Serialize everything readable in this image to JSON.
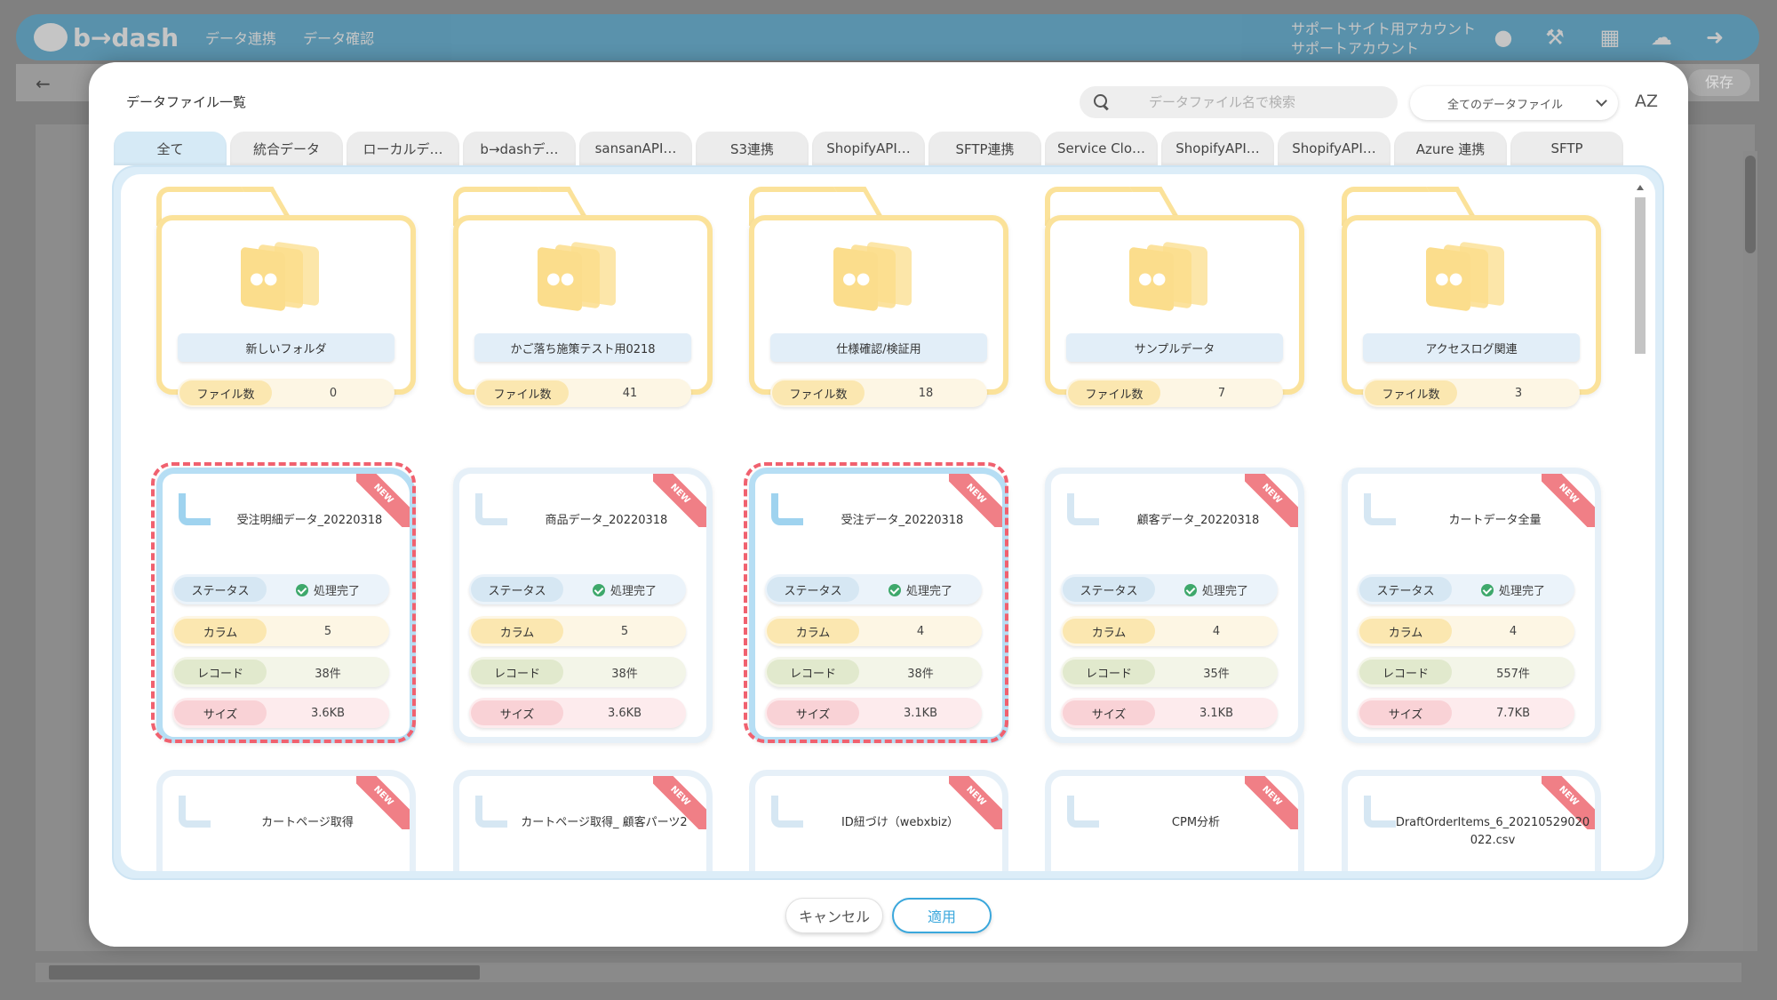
{
  "app": {
    "logo": "b→dash",
    "nav": [
      "データ連携",
      "データ確認"
    ],
    "account_line1": "サポートサイト用アカウント",
    "account_line2": "サポートアカウント",
    "save_label": "保存"
  },
  "modal": {
    "title": "データファイル一覧",
    "search_placeholder": "データファイル名で検索",
    "filter_selected": "全てのデータファイル",
    "sort_label": "AZ",
    "tabs": [
      "全て",
      "統合データ",
      "ローカルデ…",
      "b→dashデ…",
      "sansanAPI…",
      "S3連携",
      "ShopifyAPI…",
      "SFTP連携",
      "Service Clo…",
      "ShopifyAPI…",
      "ShopifyAPI…",
      "Azure 連携",
      "SFTP"
    ],
    "active_tab": "全て",
    "folders": [
      {
        "name": "新しいフォルダ",
        "count_label": "ファイル数",
        "count": "0"
      },
      {
        "name": "かご落ち施策テスト用0218",
        "count_label": "ファイル数",
        "count": "41"
      },
      {
        "name": "仕様確認/検証用",
        "count_label": "ファイル数",
        "count": "18"
      },
      {
        "name": "サンプルデータ",
        "count_label": "ファイル数",
        "count": "7"
      },
      {
        "name": "アクセスログ関連",
        "count_label": "ファイル数",
        "count": "3"
      }
    ],
    "labels": {
      "status": "ステータス",
      "column": "カラム",
      "record": "レコード",
      "size": "サイズ",
      "new": "NEW"
    },
    "files": [
      {
        "name": "受注明細データ_20220318",
        "status": "処理完了",
        "columns": "5",
        "records": "38件",
        "size": "3.6KB",
        "selected": true
      },
      {
        "name": "商品データ_20220318",
        "status": "処理完了",
        "columns": "5",
        "records": "38件",
        "size": "3.6KB",
        "selected": false
      },
      {
        "name": "受注データ_20220318",
        "status": "処理完了",
        "columns": "4",
        "records": "38件",
        "size": "3.1KB",
        "selected": true
      },
      {
        "name": "顧客データ_20220318",
        "status": "処理完了",
        "columns": "4",
        "records": "35件",
        "size": "3.1KB",
        "selected": false
      },
      {
        "name": "カートデータ全量",
        "status": "処理完了",
        "columns": "4",
        "records": "557件",
        "size": "7.7KB",
        "selected": false
      }
    ],
    "files_row3": [
      {
        "name": "カートページ取得"
      },
      {
        "name": "カートページ取得_ 顧客パーツ2"
      },
      {
        "name": "ID紐づけ（webxbiz）"
      },
      {
        "name": "CPM分析"
      },
      {
        "name": "DraftOrderItems_6_20210529020022.csv"
      }
    ],
    "cancel_label": "キャンセル",
    "apply_label": "適用"
  }
}
